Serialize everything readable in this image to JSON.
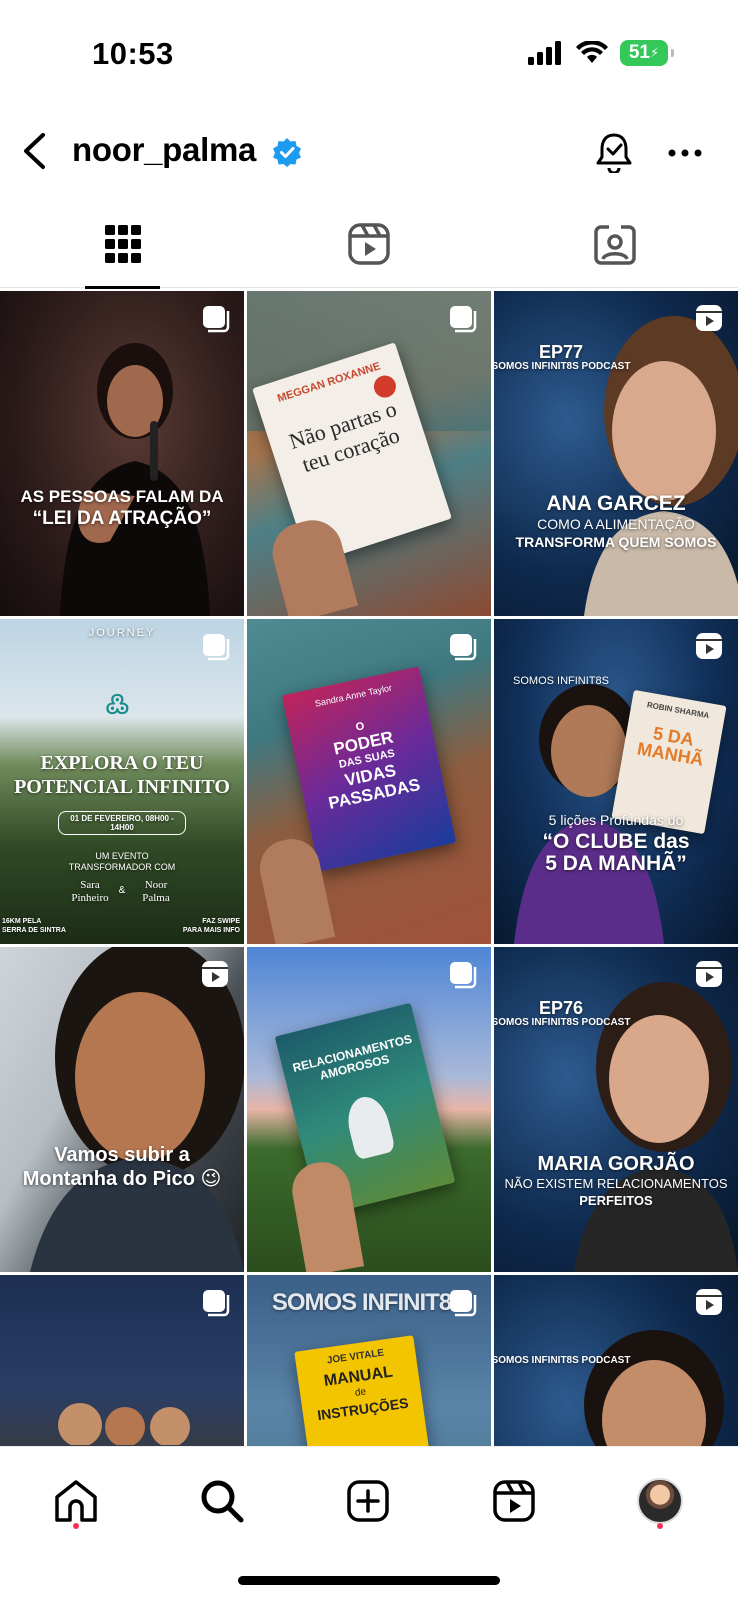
{
  "status": {
    "time": "10:53",
    "battery": "51"
  },
  "header": {
    "username": "noor_palma"
  },
  "tabs": [
    "grid-tab",
    "reels-tab",
    "tagged-tab"
  ],
  "posts": {
    "p1": {
      "caption_line1": "AS PESSOAS FALAM DA",
      "caption_line2": "“LEI DA ATRAÇÃO”"
    },
    "p2": {
      "author": "MEGGAN ROXANNE",
      "title": "Não partas o teu coração"
    },
    "p3": {
      "episode": "EP77",
      "podcast": "SOMOS INFINIT8S PODCAST",
      "guest": "ANA GARCEZ",
      "line1": "COMO A ALIMENTAÇÃO",
      "line2": "TRANSFORMA QUEM SOMOS"
    },
    "p4": {
      "top": "JOURNEY",
      "title1": "EXPLORA O TEU",
      "title2": "POTENCIAL INFINITO",
      "date": "01 DE FEVEREIRO, 08H00 - 14H00",
      "event1": "UM EVENTO",
      "event2": "TRANSFORMADOR COM",
      "name1a": "Sara",
      "name1b": "Pinheiro",
      "amp": "&",
      "name2a": "Noor",
      "name2b": "Palma",
      "left_note1": "16KM PELA",
      "left_note2": "SERRA DE SINTRA",
      "right_note1": "FAZ SWIPE",
      "right_note2": "PARA MAIS INFO"
    },
    "p5": {
      "author": "Sandra Anne Taylor",
      "title1": "O",
      "title2": "PODER",
      "title3": "DAS SUAS",
      "title4": "VIDAS",
      "title5": "PASSADAS"
    },
    "p6": {
      "podcast": "SOMOS INFINIT8S",
      "book_author": "ROBIN SHARMA",
      "book_title": "5 DA MANHÃ",
      "line1": "5 lições Profundas do",
      "line2": "“O CLUBE das",
      "line3": "5 DA MANHÃ”"
    },
    "p7": {
      "line1": "Vamos subir a",
      "line2": "Montanha do Pico 😉"
    },
    "p8": {
      "title": "RELACIONAMENTOS AMOROSOS"
    },
    "p9": {
      "episode": "EP76",
      "podcast": "SOMOS INFINIT8S PODCAST",
      "guest": "MARIA GORJÃO",
      "line1": "NÃO EXISTEM RELACIONAMENTOS",
      "line2": "PERFEITOS"
    },
    "p11": {
      "header": "SOMOS INFINIT8S",
      "author": "JOE VITALE",
      "title1": "MANUAL",
      "title2": "de",
      "title3": "INSTRUÇÕES"
    },
    "p12": {
      "podcast": "SOMOS INFINIT8S PODCAST"
    }
  },
  "nav": [
    "home",
    "search",
    "create",
    "reels",
    "profile"
  ]
}
